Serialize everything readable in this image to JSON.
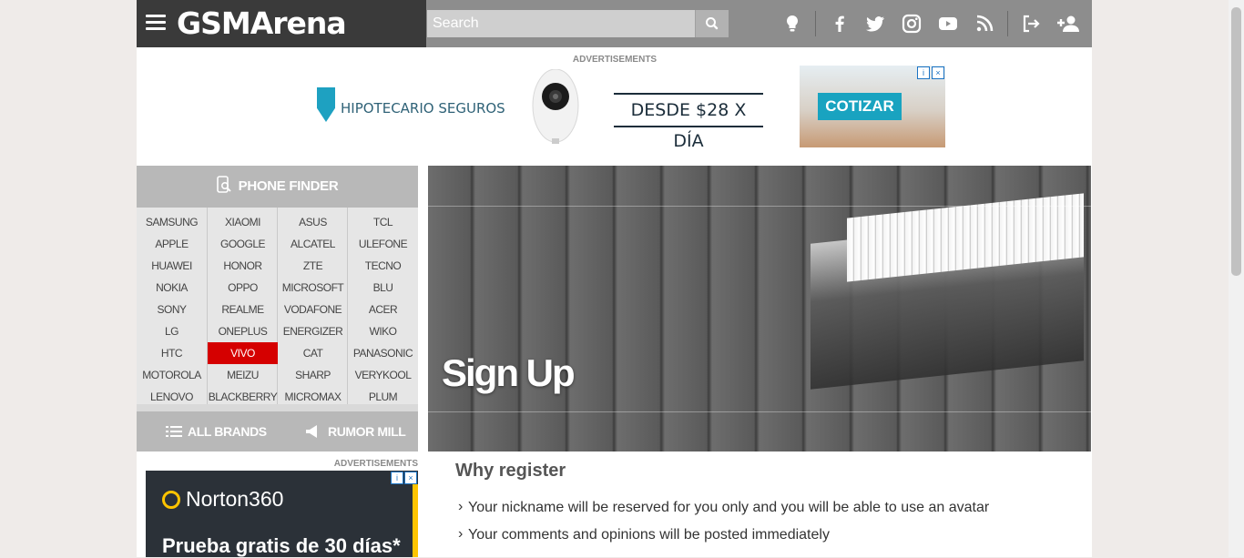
{
  "header": {
    "logo": "GSMArena",
    "search_placeholder": "Search",
    "icons": [
      "tip-us-icon",
      "facebook-icon",
      "twitter-icon",
      "instagram-icon",
      "youtube-icon",
      "rss-icon",
      "login-icon",
      "signup-icon"
    ]
  },
  "ads": {
    "label": "ADVERTISEMENTS",
    "top": {
      "brand": "HIPOTECARIO SEGUROS",
      "price": "DESDE $28 X DÍA",
      "cta": "COTIZAR"
    },
    "side": {
      "brand": "Norton360",
      "promo": "Prueba gratis de 30 días*"
    }
  },
  "phone_finder": {
    "title": "PHONE FINDER",
    "columns": [
      [
        "SAMSUNG",
        "APPLE",
        "HUAWEI",
        "NOKIA",
        "SONY",
        "LG",
        "HTC",
        "MOTOROLA",
        "LENOVO"
      ],
      [
        "XIAOMI",
        "GOOGLE",
        "HONOR",
        "OPPO",
        "REALME",
        "ONEPLUS",
        "VIVO",
        "MEIZU",
        "BLACKBERRY"
      ],
      [
        "ASUS",
        "ALCATEL",
        "ZTE",
        "MICROSOFT",
        "VODAFONE",
        "ENERGIZER",
        "CAT",
        "SHARP",
        "MICROMAX"
      ],
      [
        "TCL",
        "ULEFONE",
        "TECNO",
        "BLU",
        "ACER",
        "WIKO",
        "PANASONIC",
        "VERYKOOL",
        "PLUM"
      ]
    ],
    "active_brand": "VIVO",
    "all_brands": "ALL BRANDS",
    "rumor_mill": "RUMOR MILL"
  },
  "hero": {
    "title": "Sign Up"
  },
  "content": {
    "why_title": "Why register",
    "reasons": [
      "Your nickname will be reserved for you only and you will be able to use an avatar",
      "Your comments and opinions will be posted immediately"
    ]
  },
  "colors": {
    "accent_red": "#d50000",
    "header_dark": "#3a3a3a",
    "header_gray": "#8d8d8d"
  }
}
